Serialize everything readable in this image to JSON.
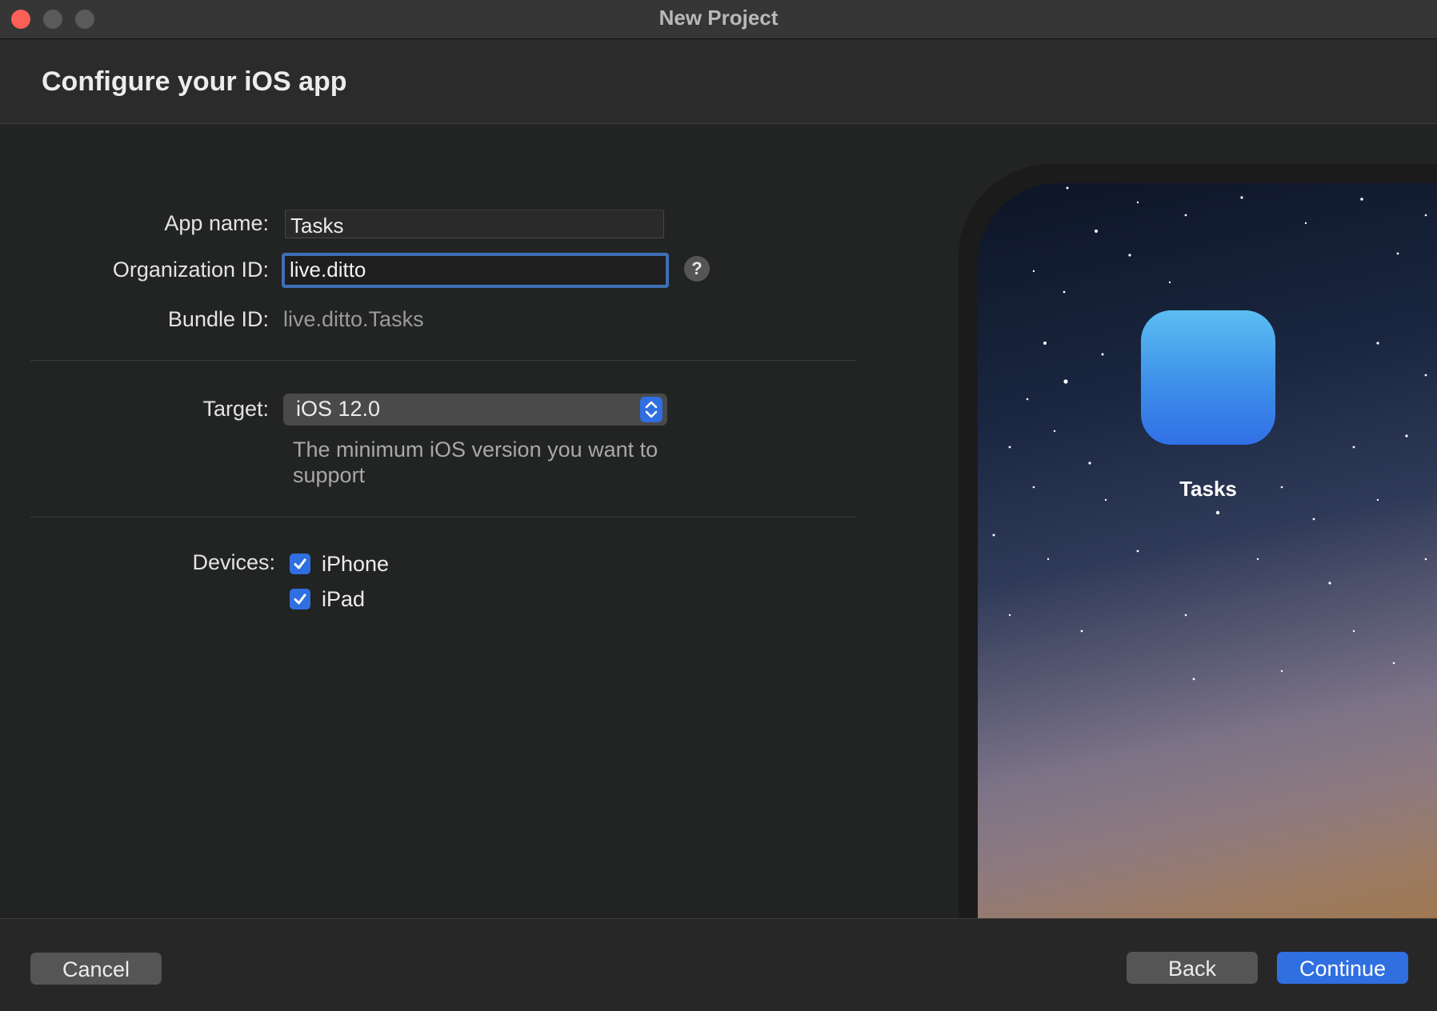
{
  "window": {
    "title": "New Project"
  },
  "header": {
    "title": "Configure your iOS app"
  },
  "form": {
    "app_name_label": "App name:",
    "app_name_value": "Tasks",
    "org_id_label": "Organization ID:",
    "org_id_value": "live.ditto",
    "help_label": "?",
    "bundle_id_label": "Bundle ID:",
    "bundle_id_value": "live.ditto.Tasks",
    "target_label": "Target:",
    "target_value": "iOS 12.0",
    "target_hint": "The minimum iOS version you want to support",
    "devices_label": "Devices:",
    "devices": [
      {
        "label": "iPhone",
        "checked": true
      },
      {
        "label": "iPad",
        "checked": true
      }
    ]
  },
  "preview": {
    "app_label": "Tasks"
  },
  "footer": {
    "cancel_label": "Cancel",
    "back_label": "Back",
    "continue_label": "Continue"
  },
  "colors": {
    "accent": "#2f6fe0",
    "close": "#fe5f57",
    "background": "#222323"
  }
}
